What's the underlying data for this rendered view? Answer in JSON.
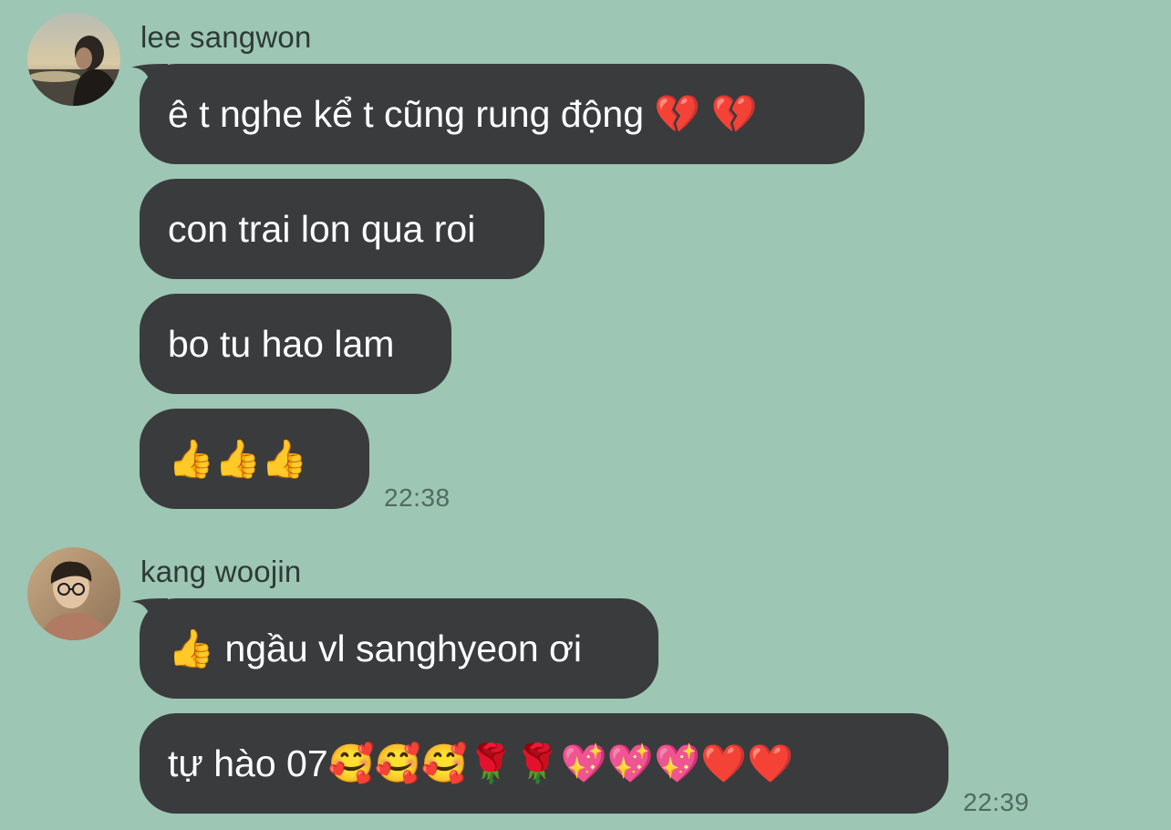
{
  "groups": [
    {
      "sender": "lee sangwon",
      "messages": [
        "ê t nghe kể t cũng rung động 💔 💔",
        "con trai lon qua roi",
        "bo tu hao lam",
        "👍👍👍"
      ],
      "time": "22:38"
    },
    {
      "sender": "kang woojin",
      "messages": [
        "👍 ngầu vl sanghyeon ơi",
        "tự hào 07🥰🥰🥰🌹🌹💖💖💖❤️❤️"
      ],
      "time": "22:39"
    }
  ],
  "colors": {
    "background": "#9dc6b5",
    "bubble": "#3a3b3d",
    "bubble_text": "#ffffff",
    "sender_text": "#2d3b36",
    "time_text": "#4f6b61"
  }
}
